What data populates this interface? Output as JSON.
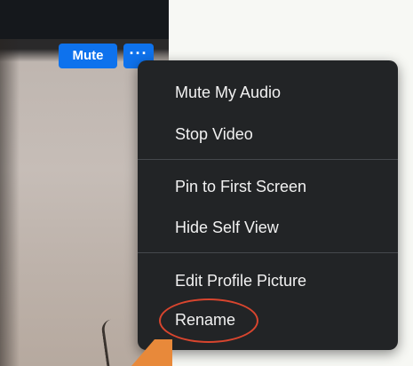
{
  "controls": {
    "mute_label": "Mute",
    "more_label": "···"
  },
  "menu": {
    "items": [
      {
        "label": "Mute My Audio"
      },
      {
        "label": "Stop Video"
      },
      {
        "label": "Pin to First Screen"
      },
      {
        "label": "Hide Self View"
      },
      {
        "label": "Edit Profile Picture"
      },
      {
        "label": "Rename"
      }
    ]
  },
  "colors": {
    "accent": "#0e72ed",
    "menu_background": "#222426",
    "highlight_ring": "#d8452e",
    "arrow": "#e8893a"
  },
  "icons": {
    "more": "more-dots-icon",
    "arrow": "arrow-pointer-icon"
  }
}
